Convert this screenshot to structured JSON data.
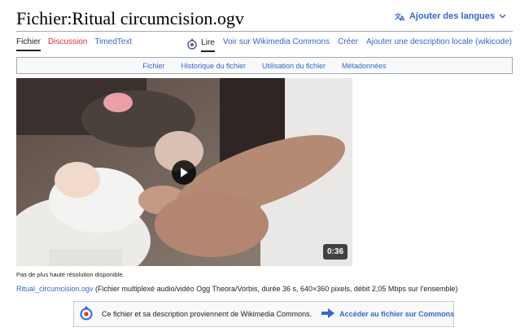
{
  "page": {
    "title": "Fichier:Ritual circumcision.ogv",
    "language_button": "Ajouter des langues"
  },
  "tabs_left": [
    {
      "label": "Fichier"
    },
    {
      "label": "Discussion"
    },
    {
      "label": "TimedText"
    }
  ],
  "tabs_right": [
    {
      "label": "Lire"
    },
    {
      "label": "Voir sur Wikimedia Commons"
    },
    {
      "label": "Créer"
    },
    {
      "label": "Ajouter une description locale (wikicode)"
    }
  ],
  "file_nav": [
    {
      "label": "Fichier"
    },
    {
      "label": "Historique du fichier"
    },
    {
      "label": "Utilisation du fichier"
    },
    {
      "label": "Métadonnées"
    }
  ],
  "video": {
    "duration": "0:36"
  },
  "no_hires": "Pas de plus haute résolution disponible.",
  "file_meta": {
    "link": "Ritual_circumcision.ogv",
    "details": " (Fichier multiplexé audio/vidéo Ogg Theora/Vorbis, durée 36 s, 640×360 pixels, débit 2,05 Mbps sur l’ensemble)"
  },
  "commons_box": {
    "message": "Ce fichier et sa description proviennent de Wikimedia Commons.",
    "link": "Accéder au fichier sur Commons"
  },
  "colors": {
    "link": "#3366cc",
    "redlink": "#d73333"
  }
}
